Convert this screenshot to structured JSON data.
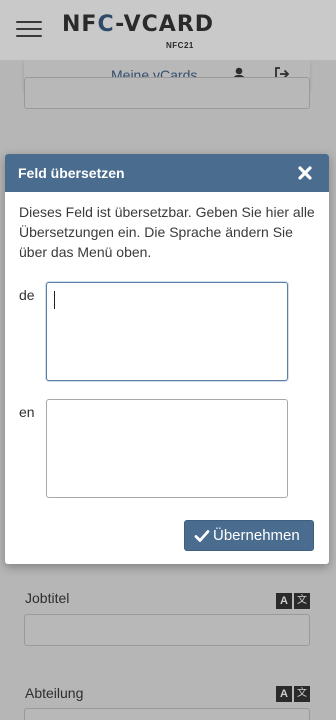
{
  "header": {
    "logo_prefix": "NF",
    "logo_c": "C",
    "logo_suffix": "-VCARD",
    "logo_sub": "NFC21"
  },
  "subnav": {
    "my_vcards_label": "Meine vCards"
  },
  "background_form": {
    "fields": [
      {
        "label": "Jobtitel",
        "value": ""
      },
      {
        "label": "Abteilung",
        "value": ""
      }
    ],
    "translate_icon_a": "A",
    "translate_icon_b": "文"
  },
  "modal": {
    "title": "Feld übersetzen",
    "description": "Dieses Feld ist übersetzbar. Geben Sie hier alle Übersetzungen ein. Die Sprache ändern Sie über das Menü oben.",
    "languages": [
      {
        "code": "de",
        "value": ""
      },
      {
        "code": "en",
        "value": ""
      }
    ],
    "apply_label": "Übernehmen"
  },
  "colors": {
    "primary": "#4a6c8e",
    "overlay_bg": "#b6b6b6"
  },
  "icons": {
    "menu": "hamburger-icon",
    "user": "user-icon",
    "logout": "sign-out-icon",
    "close": "close-icon",
    "check": "check-icon",
    "translate": "translate-icon"
  }
}
